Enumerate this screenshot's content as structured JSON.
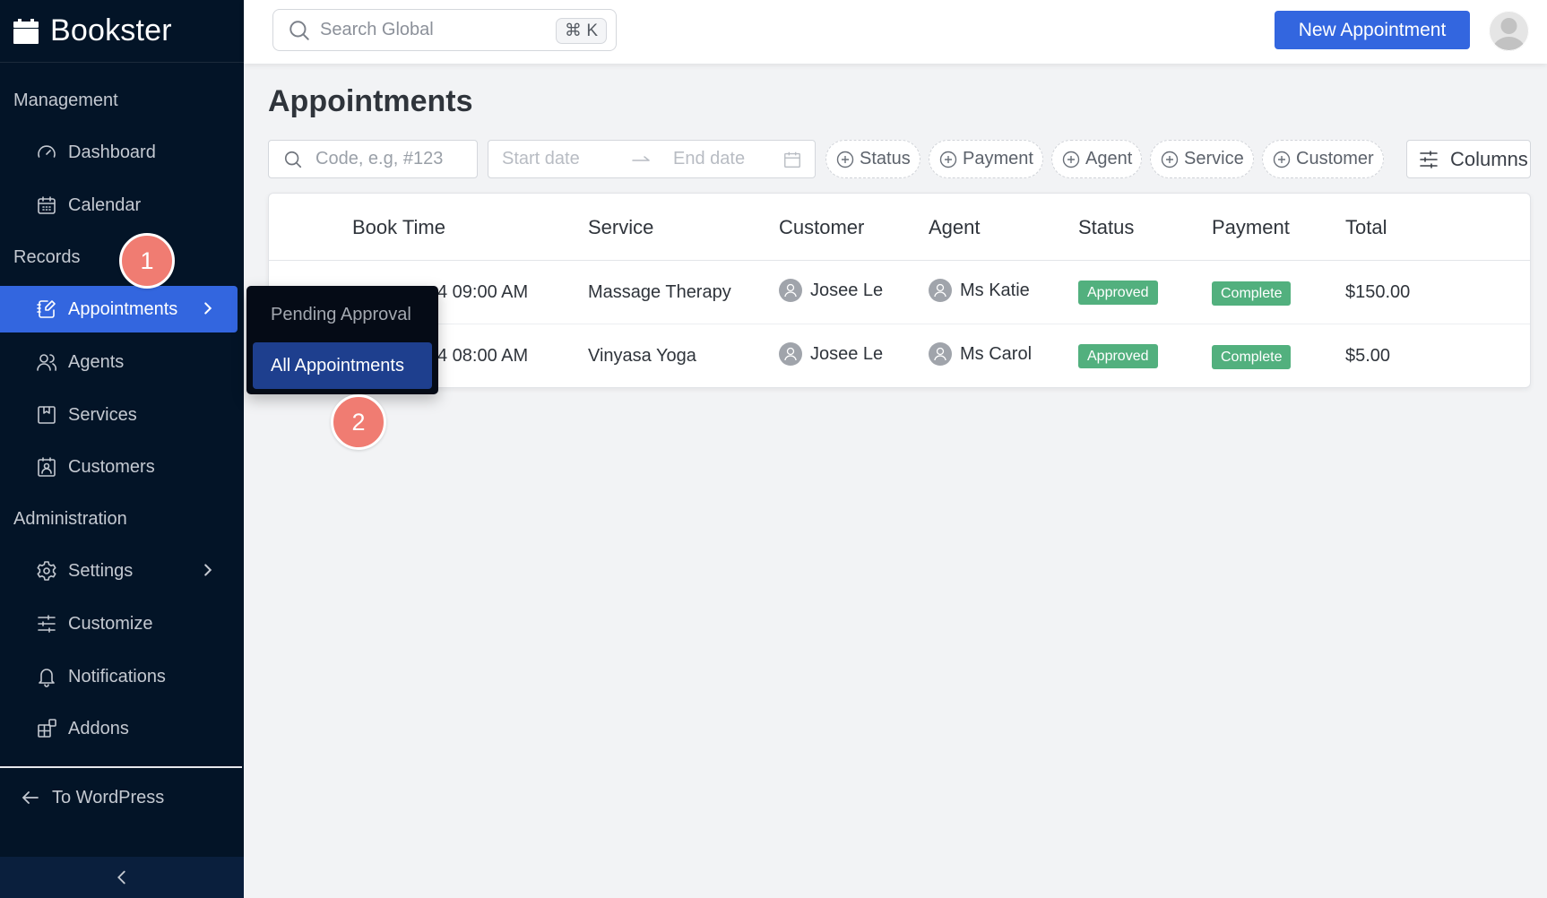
{
  "app": {
    "name": "Bookster"
  },
  "colors": {
    "sidebar_bg": "#031427",
    "accent": "#3366df",
    "success": "#52b07e",
    "step_badge": "#f07c72",
    "submenu_selected": "#1e3f8e"
  },
  "sidebar": {
    "sections": [
      {
        "label": "Management",
        "items": [
          {
            "label": "Dashboard",
            "icon": "gauge-icon"
          },
          {
            "label": "Calendar",
            "icon": "calendar-icon"
          }
        ]
      },
      {
        "label": "Records",
        "items": [
          {
            "label": "Appointments",
            "icon": "notebook-pen-icon",
            "active": true,
            "has_submenu": true
          },
          {
            "label": "Agents",
            "icon": "users-icon"
          },
          {
            "label": "Services",
            "icon": "bookmark-box-icon"
          },
          {
            "label": "Customers",
            "icon": "contact-card-icon"
          }
        ]
      },
      {
        "label": "Administration",
        "items": [
          {
            "label": "Settings",
            "icon": "gear-icon",
            "has_submenu": true
          },
          {
            "label": "Customize",
            "icon": "sliders-icon"
          },
          {
            "label": "Notifications",
            "icon": "bell-icon"
          },
          {
            "label": "Addons",
            "icon": "blocks-icon"
          }
        ]
      }
    ],
    "footer_link": "To WordPress",
    "collapse_icon": "chevron-left-icon"
  },
  "topbar": {
    "search_placeholder": "Search Global",
    "shortcut": "⌘ K",
    "new_button": "New Appointment"
  },
  "submenu": {
    "items": [
      {
        "label": "Pending Approval",
        "selected": false
      },
      {
        "label": "All Appointments",
        "selected": true
      }
    ]
  },
  "page": {
    "title": "Appointments",
    "filters": {
      "code_placeholder": "Code, e.g, #123",
      "start_date_placeholder": "Start date",
      "end_date_placeholder": "End date",
      "chips": [
        "Status",
        "Payment",
        "Agent",
        "Service",
        "Customer"
      ],
      "columns_label": "Columns"
    },
    "table": {
      "columns": [
        "Book Time",
        "Service",
        "Customer",
        "Agent",
        "Status",
        "Payment",
        "Total"
      ],
      "rows": [
        {
          "book_time_visible": "4 09:00 AM",
          "service": "Massage Therapy",
          "customer": "Josee Le",
          "agent": "Ms Katie",
          "status": "Approved",
          "payment": "Complete",
          "total": "$150.00"
        },
        {
          "book_time_visible": "4 08:00 AM",
          "service": "Vinyasa Yoga",
          "customer": "Josee Le",
          "agent": "Ms Carol",
          "status": "Approved",
          "payment": "Complete",
          "total": "$5.00"
        }
      ]
    }
  },
  "annotations": {
    "step1": "1",
    "step2": "2"
  }
}
